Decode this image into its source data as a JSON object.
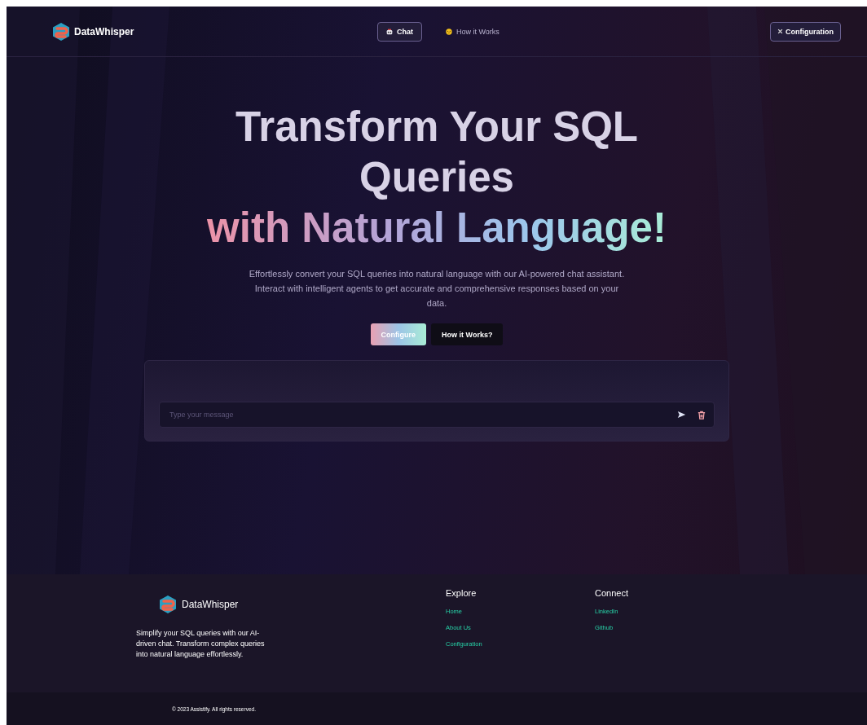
{
  "brand": {
    "name": "DataWhisper"
  },
  "nav": [
    {
      "label": "Chat",
      "kind": "robot",
      "selected": true
    },
    {
      "label": "How it Works",
      "kind": "face",
      "selected": false
    }
  ],
  "config_button": {
    "label": "Configuration"
  },
  "hero": {
    "title": "Transform Your SQL Queries",
    "highlight": "with Natural Language!",
    "subtitle": "Effortlessly convert your SQL queries into natural language with our AI-powered chat assistant. Interact with intelligent agents to get accurate and comprehensive responses based on your data.",
    "buttons": [
      {
        "label": "Configure",
        "kind": "primary"
      },
      {
        "label": "How it Works?",
        "kind": "dark"
      }
    ]
  },
  "chat": {
    "placeholder": "Type your message"
  },
  "footer": {
    "brand": "DataWhisper",
    "tagline": "Simplify your SQL queries with our AI-driven chat. Transform complex queries into natural language effortlessly.",
    "columns": [
      {
        "title": "Explore",
        "links": [
          "Home",
          "About Us",
          "Configuration"
        ]
      },
      {
        "title": "Connect",
        "links": [
          "LinkedIn",
          "Github"
        ]
      }
    ],
    "copyright": "© 2023 Assistify. All rights reserved."
  }
}
